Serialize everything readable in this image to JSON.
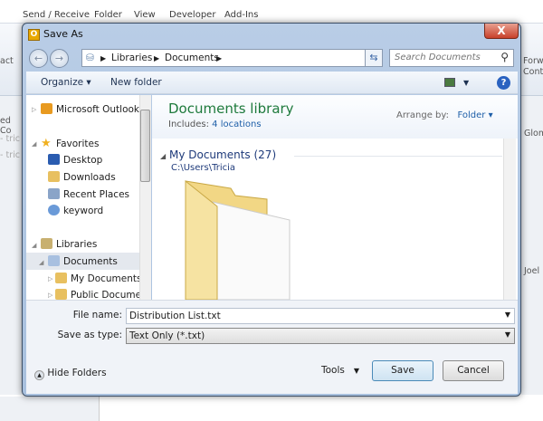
{
  "background": {
    "ribbon_tabs": [
      "Send / Receive",
      "Folder",
      "View",
      "Developer",
      "Add-Ins"
    ],
    "left_fragments": [
      "act",
      "ed Co",
      "- tric",
      "- tric"
    ],
    "right_fragments": [
      "Forwa",
      "Contac",
      "Glom",
      "Joel"
    ]
  },
  "dialog": {
    "title": "Save As",
    "app_icon_letter": "O",
    "close_label": "X",
    "address": {
      "crumbs": [
        "Libraries",
        "Documents"
      ]
    },
    "search": {
      "placeholder": "Search Documents"
    },
    "toolbar": {
      "organize": "Organize ▾",
      "new_folder": "New folder"
    },
    "nav": {
      "items": [
        {
          "label": "Microsoft Outlook",
          "icon": "outlook-icon"
        },
        {
          "label": "Favorites",
          "icon": "star-icon"
        },
        {
          "label": "Desktop",
          "icon": "desktop-icon"
        },
        {
          "label": "Downloads",
          "icon": "downloads-icon"
        },
        {
          "label": "Recent Places",
          "icon": "recent-places-icon"
        },
        {
          "label": "keyword",
          "icon": "keyword-icon"
        },
        {
          "label": "Libraries",
          "icon": "libraries-icon"
        },
        {
          "label": "Documents",
          "icon": "documents-icon",
          "selected": true
        },
        {
          "label": "My Documents",
          "icon": "folder-icon"
        },
        {
          "label": "Public Documen",
          "icon": "folder-icon"
        }
      ]
    },
    "library": {
      "title": "Documents library",
      "includes_label": "Includes:",
      "includes_link": "4 locations",
      "arrange_label": "Arrange by:",
      "arrange_value": "Folder ▾",
      "group_title": "My Documents (27)",
      "group_path": "C:\\Users\\Tricia"
    },
    "footer": {
      "file_name_label": "File name:",
      "file_name_value": "Distribution List.txt",
      "save_type_label": "Save as type:",
      "save_type_value": "Text Only (*.txt)",
      "hide_folders": "Hide Folders",
      "tools": "Tools",
      "save": "Save",
      "cancel": "Cancel"
    }
  }
}
